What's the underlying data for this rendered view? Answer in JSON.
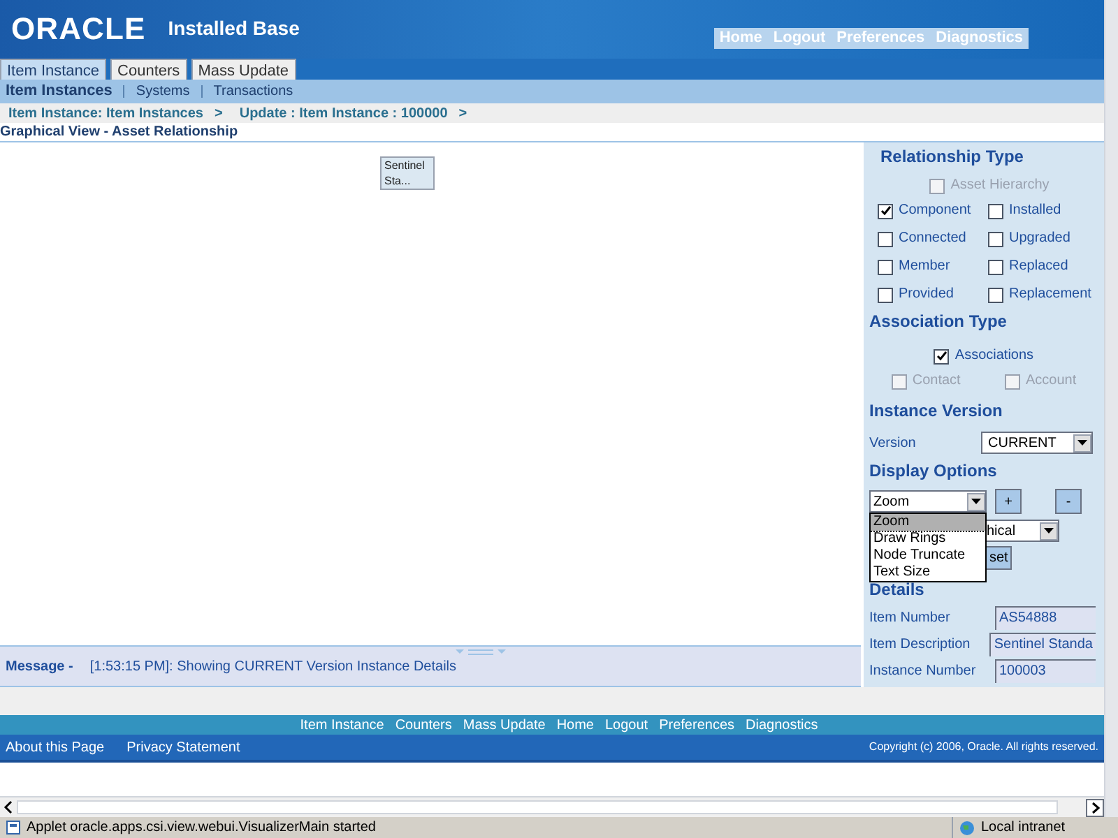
{
  "header": {
    "logo": "ORACLE",
    "app_title": "Installed Base",
    "global_links": [
      "Home",
      "Logout",
      "Preferences",
      "Diagnostics"
    ]
  },
  "tabs": [
    {
      "label": "Item Instance",
      "selected": true
    },
    {
      "label": "Counters",
      "selected": false
    },
    {
      "label": "Mass Update",
      "selected": false
    }
  ],
  "subtabs": [
    {
      "label": "Item Instances",
      "selected": true
    },
    {
      "label": "Systems",
      "selected": false
    },
    {
      "label": "Transactions",
      "selected": false
    }
  ],
  "breadcrumbs": [
    {
      "label": "Item Instance: Item Instances",
      "separator": ">"
    },
    {
      "label": "Update : Item Instance : 100000",
      "separator": ">"
    }
  ],
  "page_title": "Graphical View - Asset Relationship",
  "canvas": {
    "node": [
      "Sentinel",
      "Sta..."
    ]
  },
  "side_panel": {
    "relationship_type": {
      "heading": "Relationship Type",
      "top": {
        "label": "Asset Hierarchy",
        "checked": false,
        "disabled": true
      },
      "options": [
        {
          "label": "Component",
          "checked": true,
          "disabled": false
        },
        {
          "label": "Installed",
          "checked": false,
          "disabled": false
        },
        {
          "label": "Connected",
          "checked": false,
          "disabled": false
        },
        {
          "label": "Upgraded",
          "checked": false,
          "disabled": false
        },
        {
          "label": "Member",
          "checked": false,
          "disabled": false
        },
        {
          "label": "Replaced",
          "checked": false,
          "disabled": false
        },
        {
          "label": "Provided",
          "checked": false,
          "disabled": false
        },
        {
          "label": "Replacement",
          "checked": false,
          "disabled": false
        }
      ]
    },
    "association_type": {
      "heading": "Association Type",
      "top": {
        "label": "Associations",
        "checked": true,
        "disabled": false
      },
      "options": [
        {
          "label": "Contact",
          "checked": false,
          "disabled": true
        },
        {
          "label": "Account",
          "checked": false,
          "disabled": true
        }
      ]
    },
    "instance_version": {
      "heading": "Instance Version",
      "label": "Version",
      "value": "CURRENT"
    },
    "display_options": {
      "heading": "Display Options",
      "select_value": "Zoom",
      "plus": "+",
      "minus": "-",
      "menu": [
        {
          "label": "Zoom",
          "selected": true
        },
        {
          "label": "Draw Rings",
          "selected": false
        },
        {
          "label": "Node Truncate",
          "selected": false
        },
        {
          "label": "Text Size",
          "selected": false
        }
      ],
      "second_select_visible": "hical",
      "reset_visible": "set"
    },
    "details": {
      "heading": "Details",
      "fields": [
        {
          "label": "Item Number",
          "value": "AS54888"
        },
        {
          "label": "Item Description",
          "value": "Sentinel Standa"
        },
        {
          "label": "Instance Number",
          "value": "100003"
        }
      ]
    }
  },
  "message": {
    "label": "Message -",
    "text": "[1:53:15 PM]: Showing CURRENT Version Instance Details"
  },
  "footer": {
    "links": [
      "Item Instance",
      "Counters",
      "Mass Update",
      "Home",
      "Logout",
      "Preferences",
      "Diagnostics"
    ],
    "bottom_links": [
      "About this Page",
      "Privacy Statement"
    ],
    "copyright": "Copyright (c) 2006, Oracle. All rights reserved."
  },
  "status_bar": {
    "text": "Applet oracle.apps.csi.view.webui.VisualizerMain started",
    "zone": "Local intranet"
  }
}
